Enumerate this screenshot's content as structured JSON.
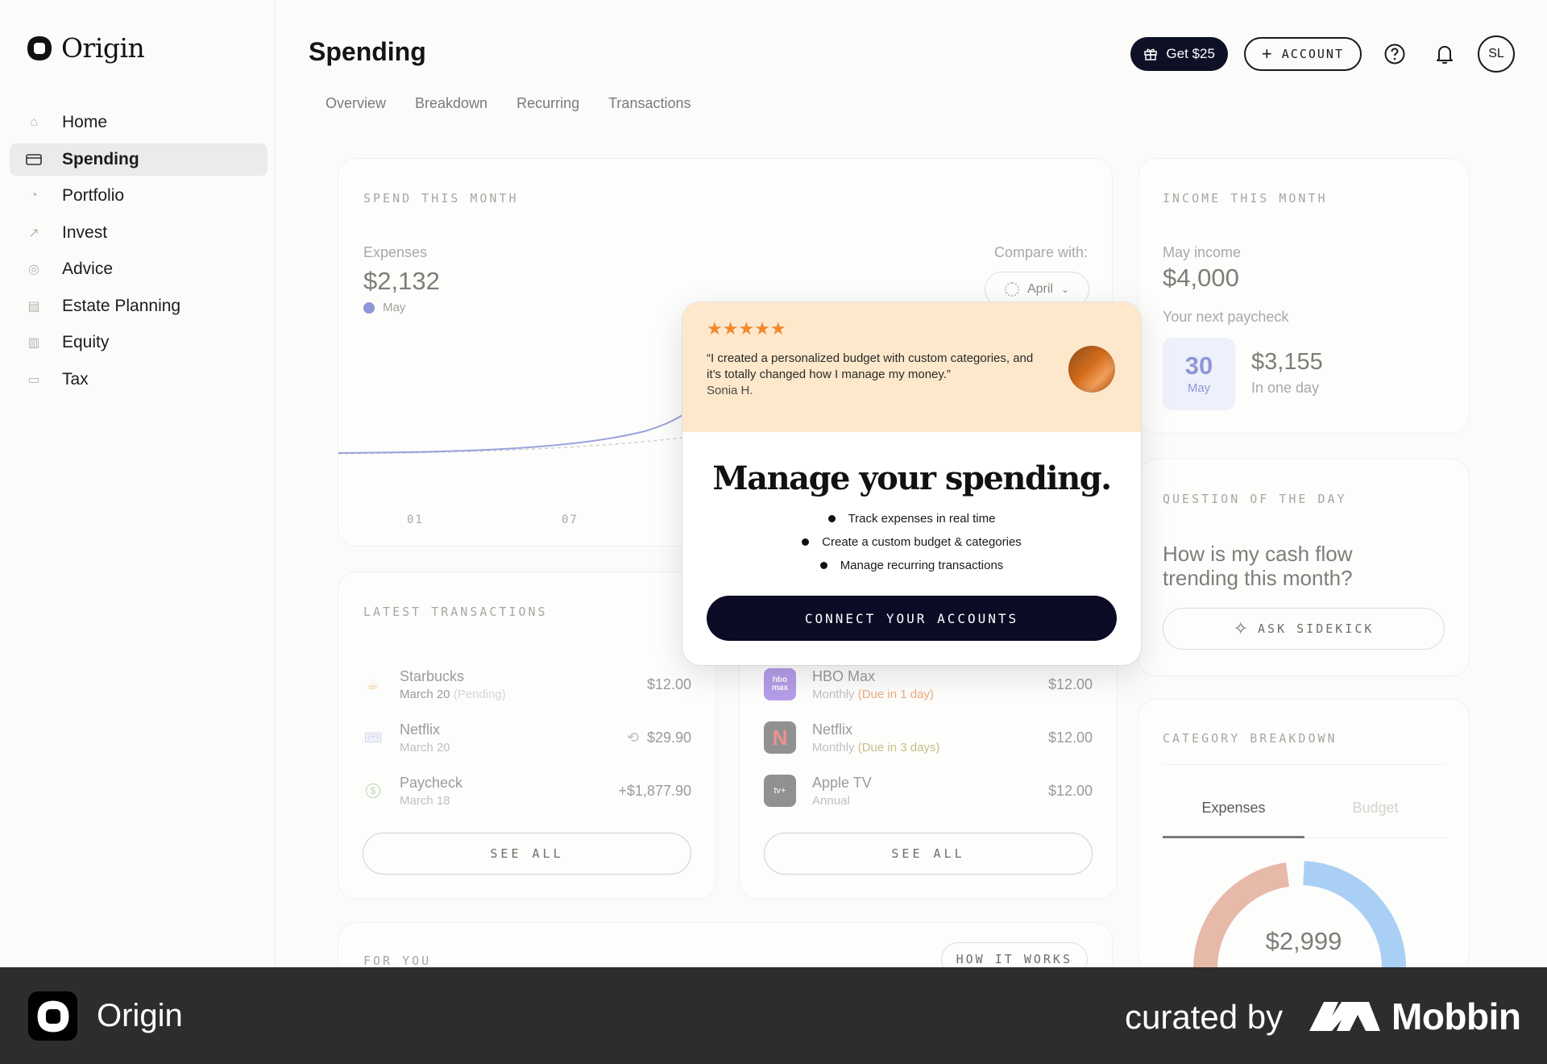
{
  "app": {
    "name": "Origin"
  },
  "sidebar": {
    "items": [
      {
        "label": "Home",
        "icon": "home-icon"
      },
      {
        "label": "Spending",
        "icon": "card-icon",
        "active": true
      },
      {
        "label": "Portfolio",
        "icon": "pie-icon"
      },
      {
        "label": "Invest",
        "icon": "trend-icon"
      },
      {
        "label": "Advice",
        "icon": "target-icon"
      },
      {
        "label": "Estate Planning",
        "icon": "building-icon"
      },
      {
        "label": "Equity",
        "icon": "bars-icon"
      },
      {
        "label": "Tax",
        "icon": "receipt-icon"
      }
    ]
  },
  "header": {
    "title": "Spending",
    "tabs": [
      "Overview",
      "Breakdown",
      "Recurring",
      "Transactions"
    ],
    "get_label": "Get $25",
    "account_label": "ACCOUNT",
    "avatar_initials": "SL"
  },
  "spend": {
    "label": "SPEND THIS MONTH",
    "expenses_label": "Expenses",
    "expenses_value": "$2,132",
    "legend": "May",
    "compare_label": "Compare with:",
    "compare_value": "April",
    "ticks": [
      "01",
      "07"
    ],
    "accent": "#8e97d8"
  },
  "income": {
    "label": "INCOME THIS MONTH",
    "month_label": "May income",
    "value": "$4,000",
    "next_label": "Your next paycheck",
    "day": "30",
    "month": "May",
    "paycheck": "$3,155",
    "when": "In one day"
  },
  "qotd": {
    "label": "QUESTION OF THE DAY",
    "question": "How is my cash flow trending this month?",
    "button": "ASK SIDEKICK"
  },
  "category": {
    "label": "CATEGORY BREAKDOWN",
    "tabs": [
      "Expenses",
      "Budget"
    ],
    "total": "$2,999"
  },
  "transactions": {
    "label": "LATEST TRANSACTIONS",
    "rows": [
      {
        "name": "Starbucks",
        "date": "March 20",
        "note": "(Pending)",
        "amount": "$12.00",
        "icon": "coffee-icon"
      },
      {
        "name": "Netflix",
        "date": "March 20",
        "note": "",
        "amount": "$29.90",
        "icon": "ticket-icon",
        "recurring": true
      },
      {
        "name": "Paycheck",
        "date": "March 18",
        "note": "",
        "amount": "+$1,877.90",
        "icon": "dollar-icon"
      }
    ],
    "see_all": "SEE ALL"
  },
  "recurring": {
    "rows": [
      {
        "name": "HBO Max",
        "sub": "Monthly",
        "due": "(Due in 1 day)",
        "amount": "$12.00",
        "logo": "hbo max",
        "color": "#7b4fd8"
      },
      {
        "name": "Netflix",
        "sub": "Monthly",
        "due": "(Due in 3 days)",
        "amount": "$12.00",
        "logo": "N",
        "color": "#3a3a3a"
      },
      {
        "name": "Apple TV",
        "sub": "Annual",
        "due": "",
        "amount": "$12.00",
        "logo": "tv+",
        "color": "#3a3a3a"
      }
    ],
    "see_all": "SEE ALL"
  },
  "foryou": {
    "label": "FOR YOU",
    "how_it_works": "HOW IT WORKS"
  },
  "modal": {
    "stars": "★★★★★",
    "quote": "“I created a personalized budget with custom categories, and it’s totally changed how I manage my money.”",
    "author": "Sonia H.",
    "title": "Manage your spending.",
    "bullets": [
      "Track expenses in real time",
      "Create a custom budget & categories",
      "Manage recurring transactions"
    ],
    "cta": "CONNECT YOUR ACCOUNTS"
  },
  "footer": {
    "app_name": "Origin",
    "curated": "curated by",
    "brand": "Mobbin"
  }
}
